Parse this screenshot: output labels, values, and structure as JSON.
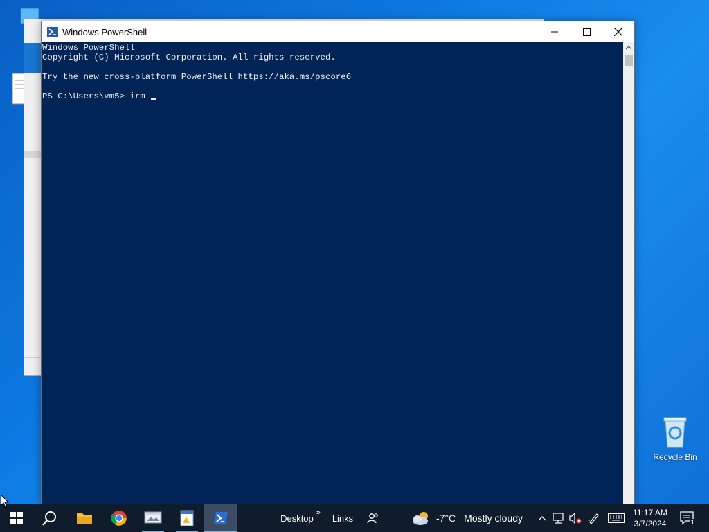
{
  "desktop": {
    "recycle_bin_label": "Recycle Bin"
  },
  "powershell": {
    "title": "Windows PowerShell",
    "lines": [
      "Windows PowerShell",
      "Copyright (C) Microsoft Corporation. All rights reserved.",
      "",
      "Try the new cross-platform PowerShell https://aka.ms/pscore6",
      ""
    ],
    "prompt": "PS C:\\Users\\vm5> ",
    "command": "irm "
  },
  "taskbar": {
    "desktop_label": "Desktop",
    "chevron": "»",
    "links_label": "Links",
    "weather_temp": "-7°C",
    "weather_desc": "Mostly cloudy",
    "time": "11:17 AM",
    "date": "3/7/2024",
    "notification_count": "1"
  },
  "colors": {
    "console_bg": "#012456",
    "console_fg": "#eeedf0",
    "command_fg": "#f9f1a5",
    "taskbar_bg": "#101c2c"
  }
}
